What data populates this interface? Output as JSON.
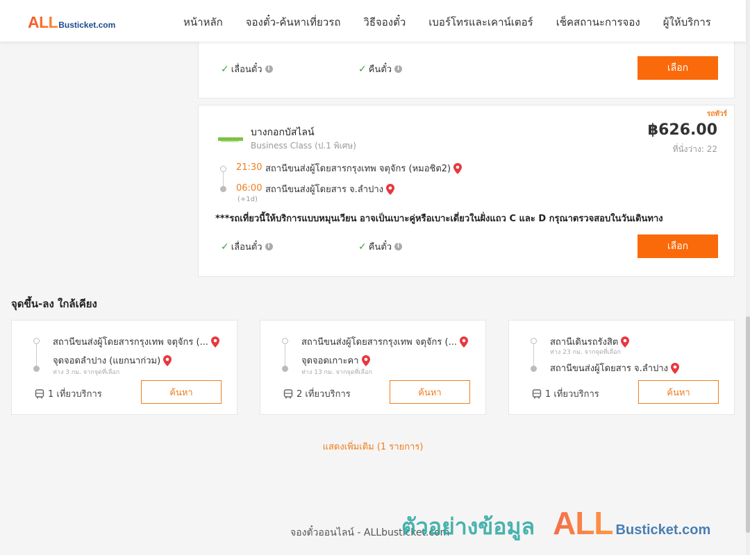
{
  "header": {
    "logo_big": "ALL",
    "logo_small": "Busticket.com",
    "nav": [
      "หน้าหลัก",
      "จองตั๋ว-ค้นหาเที่ยวรถ",
      "วิธีจองตั๋ว",
      "เบอร์โทรและเคาน์เตอร์",
      "เช็คสถานะการจอง",
      "ผู้ให้บริการ"
    ]
  },
  "card1": {
    "feature_1": "เลื่อนตั๋ว",
    "feature_2": "คืนตั๋ว",
    "select_label": "เลือก"
  },
  "card2": {
    "tag": "รถทัวร์",
    "operator": "บางกอกบัสไลน์",
    "class": "Business Class (ป.1 พิเศษ)",
    "price": "฿626.00",
    "seats": "ที่นั่งว่าง: 22",
    "departure_time": "21:30",
    "departure_station": "สถานีขนส่งผู้โดยสารกรุงเทพ จตุจักร (หมอชิต2)",
    "arrival_time": "06:00",
    "arrival_station": "สถานีขนส่งผู้โดยสาร จ.ลำปาง",
    "arrival_offset": "(+1d)",
    "notice": "***รถเที่ยวนี้ให้บริการแบบหมุนเวียน อาจเป็นเบาะคู่หรือเบาะเดี่ยวในฝั่งแถว C และ D กรุณาตรวจสอบในวันเดินทาง",
    "feature_1": "เลื่อนตั๋ว",
    "feature_2": "คืนตั๋ว",
    "select_label": "เลือก"
  },
  "nearby": {
    "title": "จุดขึ้น-ลง ใกล้เคียง",
    "search_label": "ค้นหา",
    "items": [
      {
        "from": "สถานีขนส่งผู้โดยสารกรุงเทพ จตุจักร (...",
        "from_sub": "",
        "to": "จุดจอดลำปาง (แยกนาก่วม)",
        "to_sub": "ห่าง 3 กม. จากจุดที่เลือก",
        "trips": "1 เที่ยวบริการ"
      },
      {
        "from": "สถานีขนส่งผู้โดยสารกรุงเทพ จตุจักร (...",
        "from_sub": "",
        "to": "จุดจอดเกาะคา",
        "to_sub": "ห่าง 13 กม. จากจุดที่เลือก",
        "trips": "2 เที่ยวบริการ"
      },
      {
        "from": "สถานีเดินรถรังสิต",
        "from_sub": "ห่าง 23 กม. จากจุดที่เลือก",
        "to": "สถานีขนส่งผู้โดยสาร จ.ลำปาง",
        "to_sub": "",
        "trips": "1 เที่ยวบริการ"
      }
    ]
  },
  "show_more": "แสดงเพิ่มเติม (1 รายการ)",
  "footer": "จองตั๋วออนไลน์ - ALLbusticket.com",
  "watermark": {
    "text": "ตัวอย่างข้อมูล",
    "big": "ALL",
    "small": "Busticket.com"
  },
  "colors": {
    "accent": "#fa6a0a",
    "check": "#3aa13a",
    "link": "#f07c1b",
    "teal": "#2aa7a0"
  }
}
